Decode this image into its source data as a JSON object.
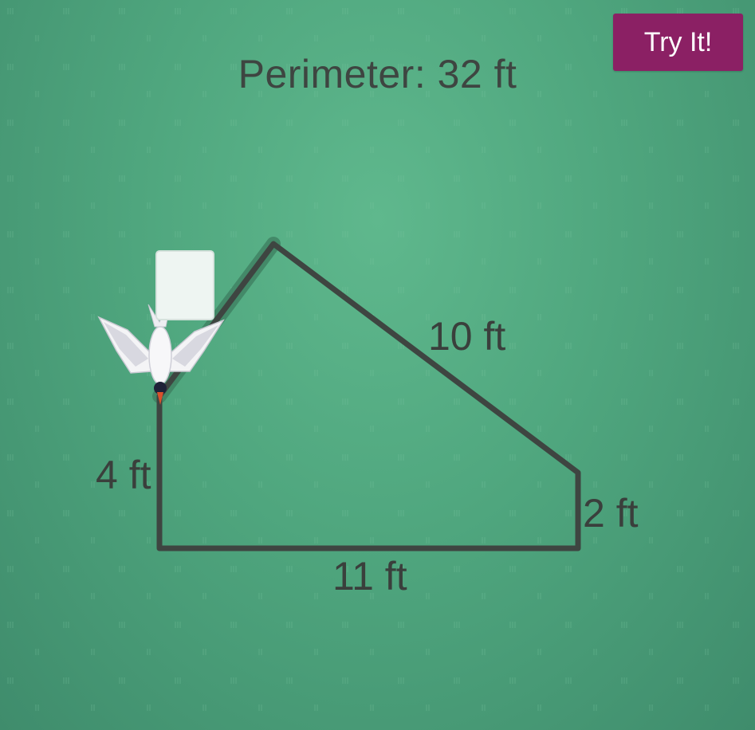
{
  "header": {
    "perimeter_text": "Perimeter: 32 ft"
  },
  "toolbar": {
    "try_label": "Try It!"
  },
  "shape": {
    "sides": [
      {
        "id": "left",
        "label": "4 ft"
      },
      {
        "id": "slanted-top",
        "label": ""
      },
      {
        "id": "diagonal",
        "label": "10 ft"
      },
      {
        "id": "right",
        "label": "2 ft"
      },
      {
        "id": "bottom",
        "label": "11 ft"
      }
    ]
  },
  "answer_box": {
    "value": ""
  },
  "colors": {
    "background": "#55ad84",
    "button": "#8b2064",
    "outline": "#3e4541",
    "highlight": "#3d7d5f",
    "answer_box": "#eef5f2"
  },
  "icons": {
    "bird": "flying-bird-icon"
  }
}
